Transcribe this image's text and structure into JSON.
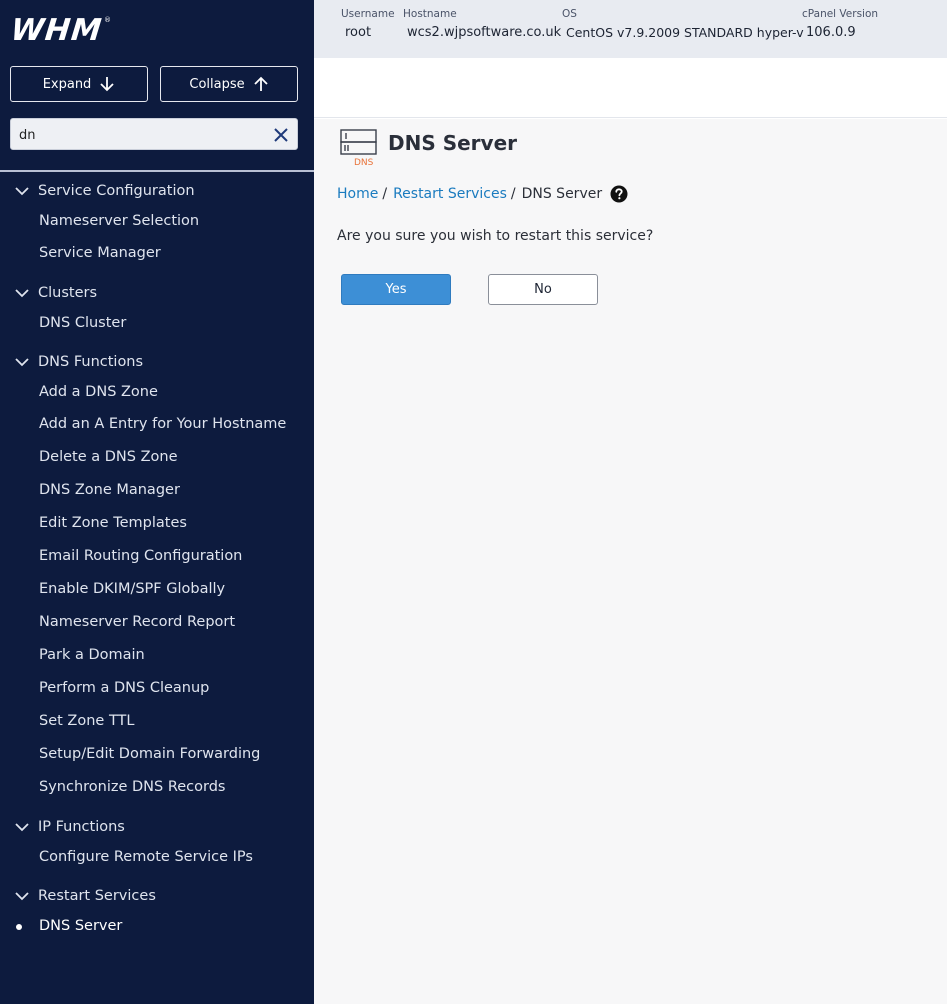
{
  "sidebar": {
    "logo": "WHM",
    "logo_mark": "®",
    "expand_label": "Expand",
    "collapse_label": "Collapse",
    "search": {
      "value": "dn",
      "placeholder": ""
    },
    "sections": [
      {
        "label": "Service Configuration",
        "items": [
          "Nameserver Selection",
          "Service Manager"
        ]
      },
      {
        "label": "Clusters",
        "items": [
          "DNS Cluster"
        ]
      },
      {
        "label": "DNS Functions",
        "items": [
          "Add a DNS Zone",
          "Add an A Entry for Your Hostname",
          "Delete a DNS Zone",
          "DNS Zone Manager",
          "Edit Zone Templates",
          "Email Routing Configuration",
          "Enable DKIM/SPF Globally",
          "Nameserver Record Report",
          "Park a Domain",
          "Perform a DNS Cleanup",
          "Set Zone TTL",
          "Setup/Edit Domain Forwarding",
          "Synchronize DNS Records"
        ]
      },
      {
        "label": "IP Functions",
        "items": [
          "Configure Remote Service IPs"
        ]
      },
      {
        "label": "Restart Services",
        "items": [
          "DNS Server"
        ]
      }
    ],
    "active_item": "DNS Server"
  },
  "infobar": {
    "username_label": "Username",
    "username": "root",
    "hostname_label": "Hostname",
    "hostname": "wcs2.wjpsoftware.co.uk",
    "os_label": "OS",
    "os": "CentOS v7.9.2009 STANDARD hyper-v",
    "version_label": "cPanel Version",
    "version": "106.0.9"
  },
  "page": {
    "icon_text": "DNS",
    "title": "DNS Server",
    "breadcrumb": {
      "home": "Home",
      "sep": "/",
      "parent": "Restart Services",
      "current": "DNS Server"
    },
    "question": "Are you sure you wish to restart this service?",
    "yes_label": "Yes",
    "no_label": "No"
  },
  "colors": {
    "sidebar_bg": "#0d1b3e",
    "accent": "#3d8fd6",
    "link": "#1a7bbf",
    "dns_icon_orange": "#e8733a"
  }
}
